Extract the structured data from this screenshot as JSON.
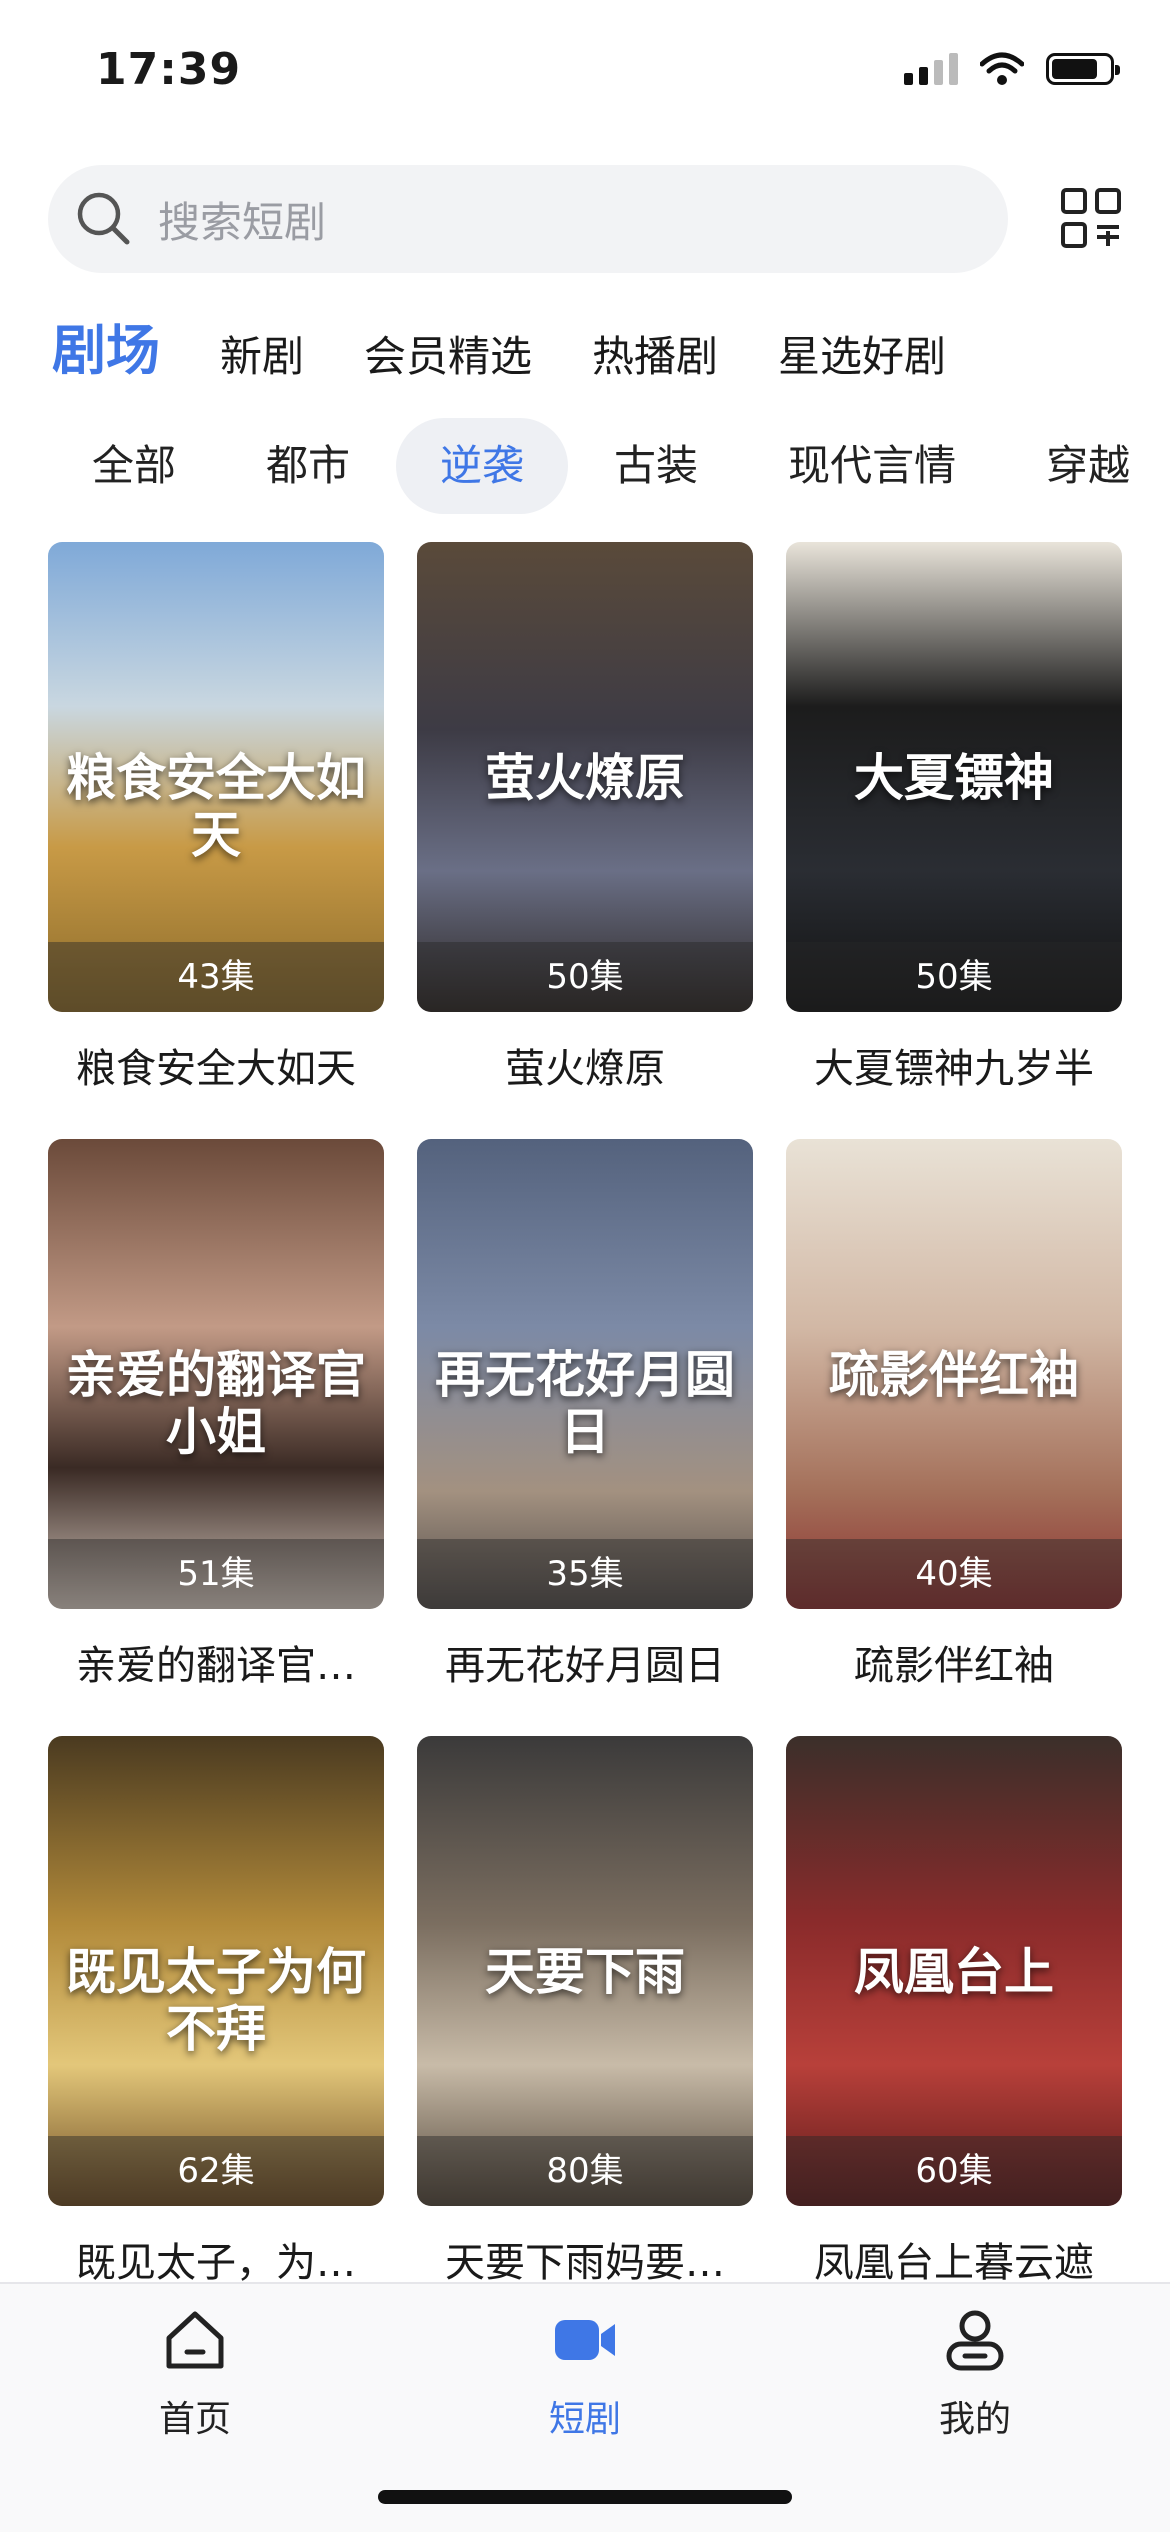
{
  "status_bar": {
    "time": "17:39"
  },
  "search": {
    "placeholder": "搜索短剧"
  },
  "category_tabs": [
    {
      "label": "剧场",
      "active": true
    },
    {
      "label": "新剧",
      "active": false
    },
    {
      "label": "会员精选",
      "active": false
    },
    {
      "label": "热播剧",
      "active": false
    },
    {
      "label": "星选好剧",
      "active": false
    }
  ],
  "genre_chips": [
    {
      "label": "全部",
      "active": false
    },
    {
      "label": "都市",
      "active": false
    },
    {
      "label": "逆袭",
      "active": true
    },
    {
      "label": "古装",
      "active": false
    },
    {
      "label": "现代言情",
      "active": false
    },
    {
      "label": "穿越",
      "active": false
    }
  ],
  "dramas": [
    {
      "title": "粮食安全大如天",
      "poster_text": "粮食安全大如天",
      "episodes": "43集"
    },
    {
      "title": "萤火燎原",
      "poster_text": "萤火燎原",
      "episodes": "50集"
    },
    {
      "title": "大夏镖神九岁半",
      "poster_text": "大夏镖神",
      "episodes": "50集"
    },
    {
      "title": "亲爱的翻译官…",
      "poster_text": "亲爱的翻译官小姐",
      "episodes": "51集"
    },
    {
      "title": "再无花好月圆日",
      "poster_text": "再无花好月圆日",
      "episodes": "35集"
    },
    {
      "title": "疏影伴红袖",
      "poster_text": "疏影伴红袖",
      "episodes": "40集"
    },
    {
      "title": "既见太子，为…",
      "poster_text": "既见太子为何不拜",
      "episodes": "62集"
    },
    {
      "title": "天要下雨妈要…",
      "poster_text": "天要下雨",
      "episodes": "80集"
    },
    {
      "title": "凤凰台上暮云遮",
      "poster_text": "凤凰台上",
      "episodes": "60集"
    }
  ],
  "bottom_nav": [
    {
      "label": "首页",
      "icon": "home-icon",
      "active": false
    },
    {
      "label": "短剧",
      "icon": "video-camera-icon",
      "active": true
    },
    {
      "label": "我的",
      "icon": "profile-icon",
      "active": false
    }
  ],
  "colors": {
    "accent": "#3f77e6",
    "search_bg": "#f2f3f5"
  }
}
